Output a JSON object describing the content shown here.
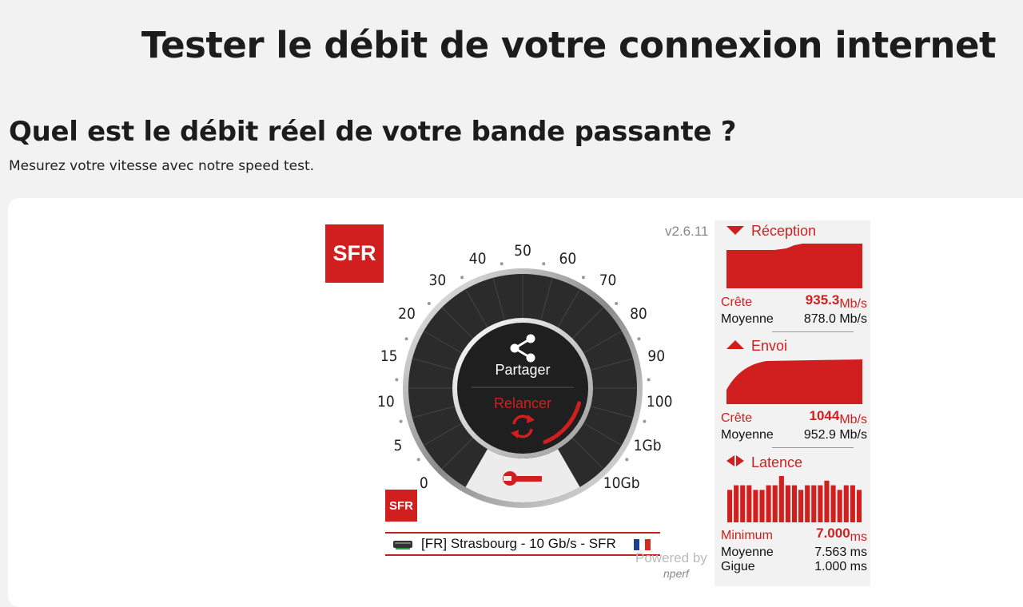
{
  "page": {
    "title": "Tester le débit de votre connexion internet",
    "heading": "Quel est le débit réel de votre bande passante ?",
    "subheading": "Mesurez votre vitesse avec notre speed test."
  },
  "speedtest": {
    "brand_logo": "SFR",
    "version": "v2.6.11",
    "gauge": {
      "scale_labels": [
        "0",
        "5",
        "10",
        "15",
        "20",
        "30",
        "40",
        "50",
        "60",
        "70",
        "80",
        "90",
        "100",
        "1Gb",
        "10Gb"
      ],
      "share_label": "Partager",
      "restart_label": "Relancer",
      "progress_fraction": 0.35
    },
    "server": {
      "name": "[FR] Strasbourg - 10 Gb/s - SFR"
    },
    "powered_by": "Powered by",
    "powered_brand": "nperf",
    "colors": {
      "accent": "#d11e1e",
      "gauge_dark": "#2b2b2b"
    }
  },
  "results": {
    "reception": {
      "title": "Réception",
      "peak_label": "Crête",
      "peak_value": "935.3",
      "peak_unit": "Mb/s",
      "avg_label": "Moyenne",
      "avg_value": "878.0 Mb/s"
    },
    "envoi": {
      "title": "Envoi",
      "peak_label": "Crête",
      "peak_value": "1044",
      "peak_unit": "Mb/s",
      "avg_label": "Moyenne",
      "avg_value": "952.9 Mb/s"
    },
    "latence": {
      "title": "Latence",
      "min_label": "Minimum",
      "min_value": "7.000",
      "min_unit": "ms",
      "avg_label": "Moyenne",
      "avg_value": "7.563 ms",
      "jitter_label": "Gigue",
      "jitter_value": "1.000 ms",
      "bars": [
        7,
        8,
        8,
        8,
        7,
        7,
        8,
        8,
        10,
        8,
        8,
        7,
        8,
        8,
        8,
        9,
        8,
        7,
        8,
        8,
        7
      ]
    }
  }
}
